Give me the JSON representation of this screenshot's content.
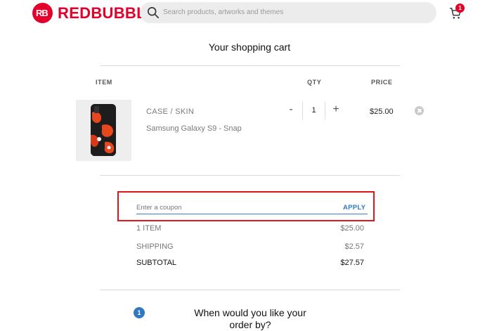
{
  "header": {
    "logo_text": "REDBUBBLE",
    "logo_mark": "RB",
    "search_placeholder": "Search products, artworks and themes",
    "cart_count": "1"
  },
  "cart": {
    "title": "Your shopping cart",
    "columns": {
      "item": "ITEM",
      "qty": "QTY",
      "price": "PRICE"
    },
    "item": {
      "type": "CASE / SKIN",
      "model": "Samsung Galaxy S9 - Snap",
      "qty_minus": "-",
      "quantity": "1",
      "qty_plus": "+",
      "price": "$25.00"
    }
  },
  "coupon": {
    "placeholder": "Enter a coupon",
    "apply_label": "APPLY",
    "highlight_color": "#e0161c"
  },
  "summary": {
    "items_label": "1 ITEM",
    "items_value": "$25.00",
    "shipping_label": "SHIPPING",
    "shipping_value": "$2.57",
    "subtotal_label": "SUBTOTAL",
    "subtotal_value": "$27.57"
  },
  "delivery": {
    "step_number": "1",
    "question": "When would you like your order by?"
  },
  "colors": {
    "brand": "#e4002b",
    "accent_blue": "#2f79c2"
  }
}
